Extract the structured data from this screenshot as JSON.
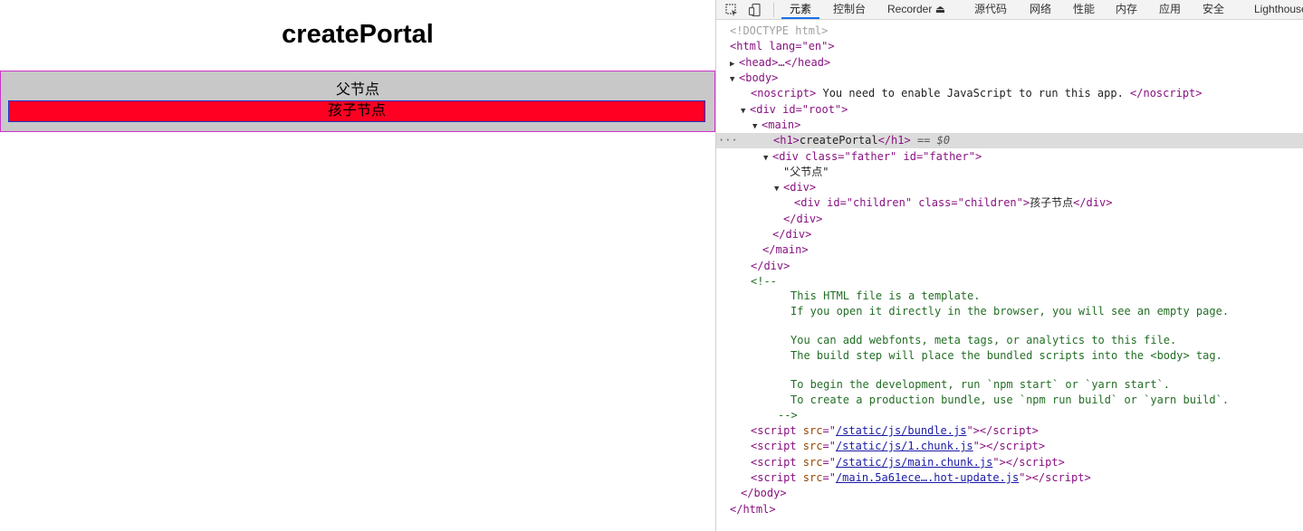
{
  "page": {
    "heading": "createPortal",
    "father_text": "父节点",
    "children_text": "孩子节点"
  },
  "devtools": {
    "tabs": [
      "元素",
      "控制台",
      "Recorder ⏏",
      "源代码",
      "网络",
      "性能",
      "内存",
      "应用",
      "安全",
      "Lighthouse"
    ],
    "active_tab": "元素",
    "dom": {
      "doctype": "<!DOCTYPE html>",
      "html_open": "<html lang=\"en\">",
      "head": "<head>…</head>",
      "body_open": "<body>",
      "noscript_open": "<noscript>",
      "noscript_text": " You need to enable JavaScript to run this app. ",
      "noscript_close": "</noscript>",
      "div_root": "<div id=\"root\">",
      "main_open": "<main>",
      "h1_line_tag_open": "<h1>",
      "h1_line_text": "createPortal",
      "h1_line_tag_close": "</h1>",
      "h1_line_suffix": " == $0",
      "father_div": "<div class=\"father\" id=\"father\">",
      "father_text": "\"父节点\"",
      "inner_div": "<div>",
      "children_div_open": "<div id=\"children\" class=\"children\">",
      "children_div_text": "孩子节点",
      "children_div_close": "</div>",
      "close_div_1": "</div>",
      "close_div_2": "</div>",
      "close_main": "</main>",
      "close_div_root": "</div>",
      "comment_open": "<!--",
      "comment_lines": [
        "This HTML file is a template.",
        "If you open it directly in the browser, you will see an empty page.",
        "You can add webfonts, meta tags, or analytics to this file.",
        "The build step will place the bundled scripts into the <body> tag.",
        "To begin the development, run `npm start` or `yarn start`.",
        "To create a production bundle, use `npm run build` or `yarn build`."
      ],
      "comment_close": "-->",
      "scripts": [
        "/static/js/bundle.js",
        "/static/js/1.chunk.js",
        "/static/js/main.chunk.js",
        "/main.5a61ece….hot-update.js"
      ],
      "body_close": "</body>",
      "html_close": "</html>"
    }
  }
}
